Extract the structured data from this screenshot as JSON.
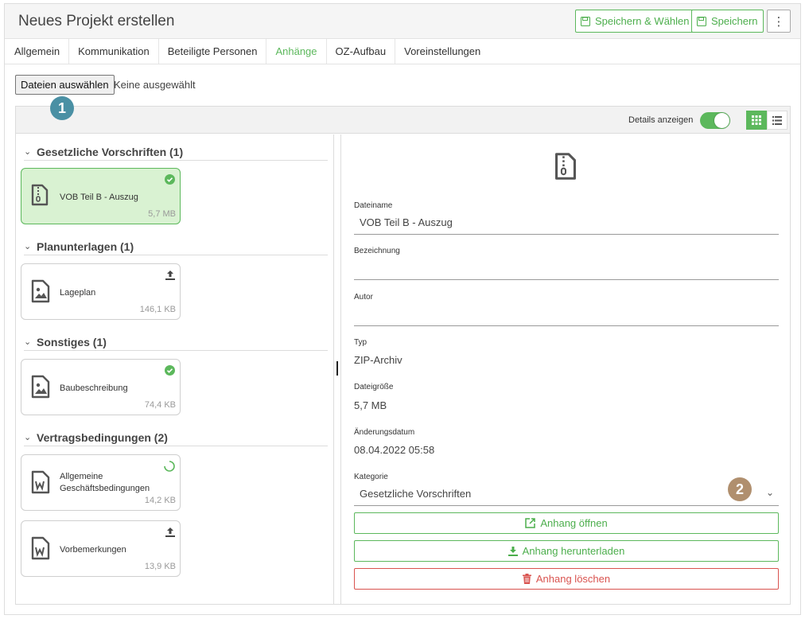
{
  "window": {
    "title": "Neues Projekt erstellen",
    "save_select_label": "Speichern & Wählen",
    "save_label": "Speichern",
    "more_label": "⋮"
  },
  "tabs": [
    {
      "label": "Allgemein"
    },
    {
      "label": "Kommunikation"
    },
    {
      "label": "Beteiligte Personen"
    },
    {
      "label": "Anhänge",
      "active": true
    },
    {
      "label": "OZ-Aufbau"
    },
    {
      "label": "Voreinstellungen"
    }
  ],
  "file_input": {
    "button_label": "Dateien auswählen",
    "status": "Keine ausgewählt"
  },
  "callouts": {
    "one": "1",
    "two": "2"
  },
  "toolbar": {
    "details_label": "Details anzeigen",
    "details_on": true,
    "view_mode": "grid"
  },
  "groups": [
    {
      "title": "Gesetzliche Vorschriften (1)",
      "files": [
        {
          "name": "VOB Teil B - Auszug",
          "size": "5,7 MB",
          "icon": "zip-file-icon",
          "status": "done",
          "selected": true
        }
      ]
    },
    {
      "title": "Planunterlagen (1)",
      "files": [
        {
          "name": "Lageplan",
          "size": "146,1 KB",
          "icon": "image-file-icon",
          "status": "upload"
        }
      ]
    },
    {
      "title": "Sonstiges (1)",
      "files": [
        {
          "name": "Baubeschreibung",
          "size": "74,4 KB",
          "icon": "image-file-icon",
          "status": "done"
        }
      ]
    },
    {
      "title": "Vertragsbedingungen (2)",
      "files": [
        {
          "name": "Allgemeine Geschäftsbedingungen",
          "size": "14,2 KB",
          "icon": "word-file-icon",
          "status": "loading"
        },
        {
          "name": "Vorbemerkungen",
          "size": "13,9 KB",
          "icon": "word-file-icon",
          "status": "upload"
        }
      ]
    }
  ],
  "details": {
    "filename_label": "Dateiname",
    "filename_value": "VOB Teil B - Auszug",
    "bezeichnung_label": "Bezeichnung",
    "bezeichnung_value": "",
    "autor_label": "Autor",
    "autor_value": "",
    "typ_label": "Typ",
    "typ_value": "ZIP-Archiv",
    "size_label": "Dateigröße",
    "size_value": "5,7 MB",
    "date_label": "Änderungsdatum",
    "date_value": "08.04.2022 05:58",
    "kategorie_label": "Kategorie",
    "kategorie_value": "Gesetzliche Vorschriften",
    "open_label": "Anhang öffnen",
    "download_label": "Anhang herunterladen",
    "delete_label": "Anhang löschen"
  },
  "colors": {
    "accent": "#5cb85c",
    "danger": "#d9534f",
    "selected_bg": "#d9f2d2",
    "callout_blue": "#4a90a4",
    "callout_brown": "#b08f6e"
  }
}
